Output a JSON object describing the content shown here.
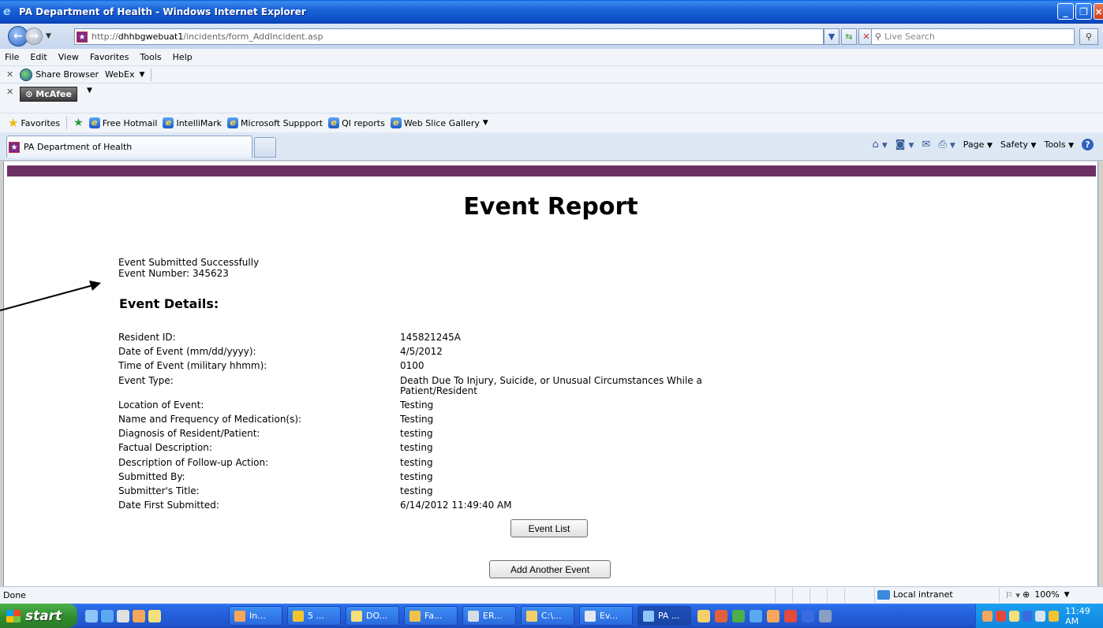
{
  "window": {
    "title": "PA Department of Health - Windows Internet Explorer"
  },
  "address": {
    "url_prefix": "http://",
    "url_host": "dhhbgwebuat1",
    "url_path": "/incidents/form_AddIncident.asp",
    "search_placeholder": "Live Search"
  },
  "menu": [
    "File",
    "Edit",
    "View",
    "Favorites",
    "Tools",
    "Help"
  ],
  "toolbar1": {
    "share_label": "Share Browser",
    "webex_label": "WebEx"
  },
  "toolbar2": {
    "mcafee_label": "McAfee"
  },
  "favorites": {
    "label": "Favorites",
    "links": [
      "Free Hotmail",
      "IntelliMark",
      "Microsoft Suppport",
      "QI reports",
      "Web Slice Gallery"
    ]
  },
  "tab": {
    "label": "PA Department of Health"
  },
  "commandbar": {
    "page": "Page",
    "safety": "Safety",
    "tools": "Tools"
  },
  "page": {
    "title": "Event Report",
    "status_line1": "Event Submitted Successfully",
    "status_line2": "Event Number: 345623",
    "details_heading": "Event Details:",
    "fields": [
      {
        "label": "Resident ID:",
        "value": "145821245A"
      },
      {
        "label": "Date of Event (mm/dd/yyyy):",
        "value": "4/5/2012"
      },
      {
        "label": "Time of Event (military hhmm):",
        "value": "0100"
      },
      {
        "label": "Event Type:",
        "value": "Death Due To Injury, Suicide, or Unusual Circumstances While a Patient/Resident"
      },
      {
        "label": "Location of Event:",
        "value": "Testing"
      },
      {
        "label": "Name and Frequency of Medication(s):",
        "value": "Testing"
      },
      {
        "label": "Diagnosis of Resident/Patient:",
        "value": "testing"
      },
      {
        "label": "Factual Description:",
        "value": "testing"
      },
      {
        "label": "Description of Follow-up Action:",
        "value": "testing"
      },
      {
        "label": "Submitted By:",
        "value": "testing"
      },
      {
        "label": "Submitter's Title:",
        "value": "testing"
      },
      {
        "label": "Date First Submitted:",
        "value": "6/14/2012 11:49:40 AM"
      }
    ],
    "event_list_button": "Event List",
    "add_another_button": "Add Another Event"
  },
  "statusbar": {
    "status": "Done",
    "zone": "Local intranet",
    "zoom": "100%"
  },
  "taskbar": {
    "start_label": "start",
    "buttons": [
      "In...",
      "5 ...",
      "DO...",
      "Fa...",
      "ER...",
      "C:\\...",
      "Ev...",
      "PA ..."
    ],
    "clock": "11:49 AM"
  },
  "colors": {
    "header_band": "#6b2f63",
    "titlebar": "#0b4cc4"
  }
}
